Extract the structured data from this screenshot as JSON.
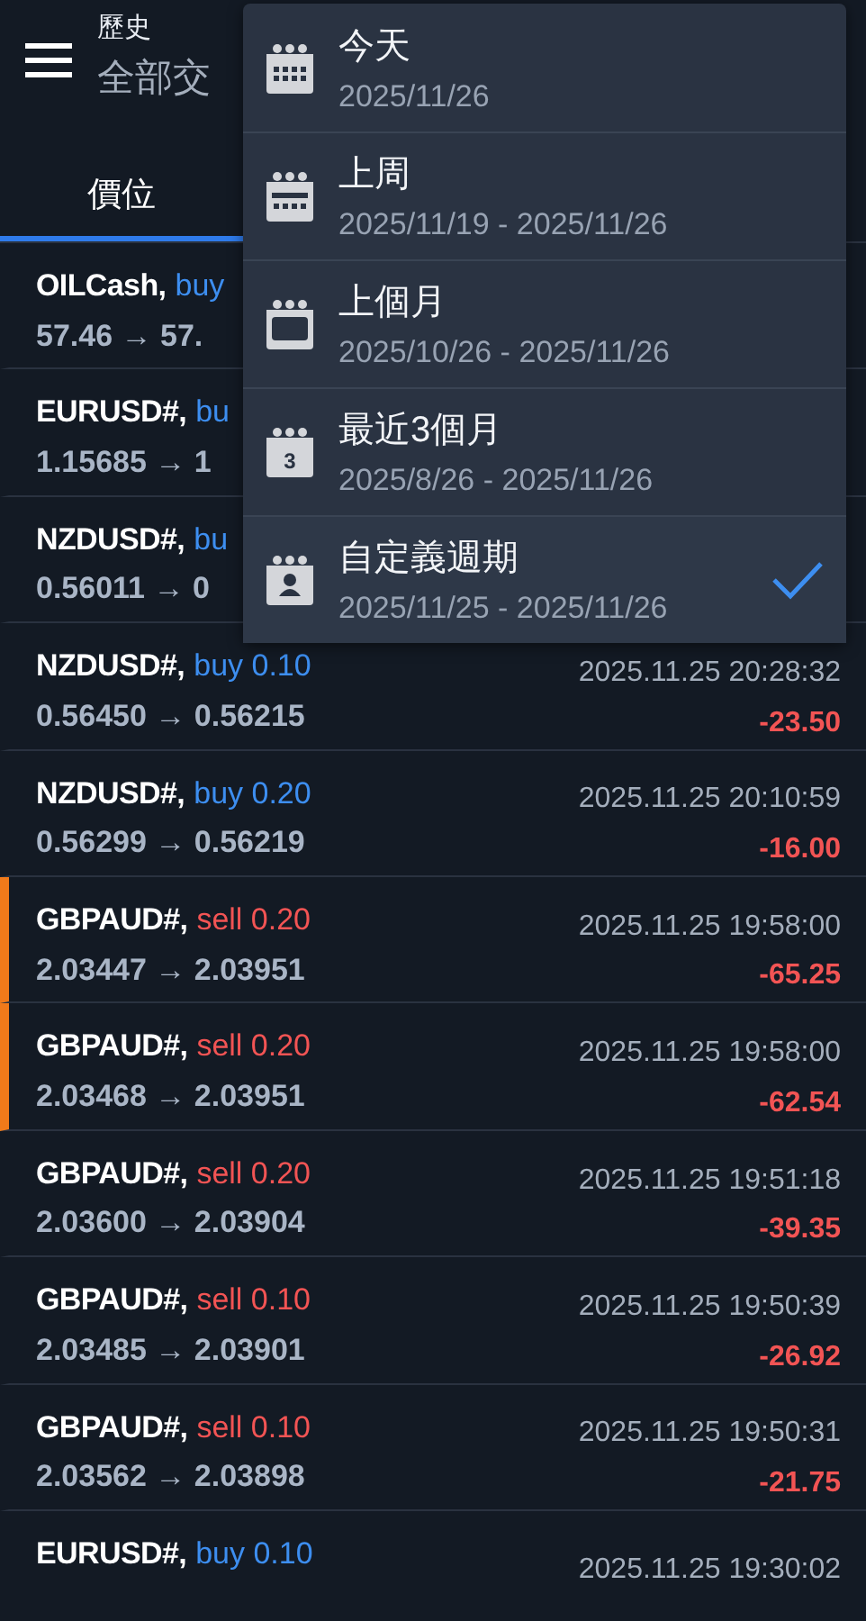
{
  "header": {
    "title": "歷史",
    "subtitle": "全部交"
  },
  "tabs": [
    {
      "label": "價位",
      "selected": true
    }
  ],
  "trades": [
    {
      "symbol": "OILCash,",
      "side": "buy",
      "kind": "buy",
      "prices": "57.46 → 57.",
      "flagged": false
    },
    {
      "symbol": "EURUSD#,",
      "side": "bu",
      "kind": "buy",
      "prices": "1.15685 → 1",
      "flagged": false
    },
    {
      "symbol": "NZDUSD#,",
      "side": "bu",
      "kind": "buy",
      "prices": "0.56011 → 0",
      "flagged": false
    },
    {
      "symbol": "NZDUSD#,",
      "side": "buy 0.10",
      "kind": "buy",
      "prices": "0.56450 → 0.56215",
      "time": "2025.11.25 20:28:32",
      "profit": "-23.50",
      "flagged": false
    },
    {
      "symbol": "NZDUSD#,",
      "side": "buy 0.20",
      "kind": "buy",
      "prices": "0.56299 → 0.56219",
      "time": "2025.11.25 20:10:59",
      "profit": "-16.00",
      "flagged": false
    },
    {
      "symbol": "GBPAUD#,",
      "side": "sell 0.20",
      "kind": "sell",
      "prices": "2.03447 → 2.03951",
      "time": "2025.11.25 19:58:00",
      "profit": "-65.25",
      "flagged": true
    },
    {
      "symbol": "GBPAUD#,",
      "side": "sell 0.20",
      "kind": "sell",
      "prices": "2.03468 → 2.03951",
      "time": "2025.11.25 19:58:00",
      "profit": "-62.54",
      "flagged": true
    },
    {
      "symbol": "GBPAUD#,",
      "side": "sell 0.20",
      "kind": "sell",
      "prices": "2.03600 → 2.03904",
      "time": "2025.11.25 19:51:18",
      "profit": "-39.35",
      "flagged": false
    },
    {
      "symbol": "GBPAUD#,",
      "side": "sell 0.10",
      "kind": "sell",
      "prices": "2.03485 → 2.03901",
      "time": "2025.11.25 19:50:39",
      "profit": "-26.92",
      "flagged": false
    },
    {
      "symbol": "GBPAUD#,",
      "side": "sell 0.10",
      "kind": "sell",
      "prices": "2.03562 → 2.03898",
      "time": "2025.11.25 19:50:31",
      "profit": "-21.75",
      "flagged": false
    },
    {
      "symbol": "EURUSD#,",
      "side": "buy 0.10",
      "kind": "buy",
      "time": "2025.11.25 19:30:02",
      "flagged": false
    }
  ],
  "period_menu": [
    {
      "kind": "day",
      "label": "今天",
      "range": "2025/11/26",
      "selected": false
    },
    {
      "kind": "week",
      "label": "上周",
      "range": "2025/11/19 - 2025/11/26",
      "selected": false
    },
    {
      "kind": "month",
      "label": "上個月",
      "range": "2025/10/26 - 2025/11/26",
      "selected": false
    },
    {
      "kind": "number",
      "label": "最近3個月",
      "range": "2025/8/26 - 2025/11/26",
      "icon_text": "3",
      "selected": false
    },
    {
      "kind": "person",
      "label": "自定義週期",
      "range": "2025/11/25 - 2025/11/26",
      "selected": true
    }
  ]
}
